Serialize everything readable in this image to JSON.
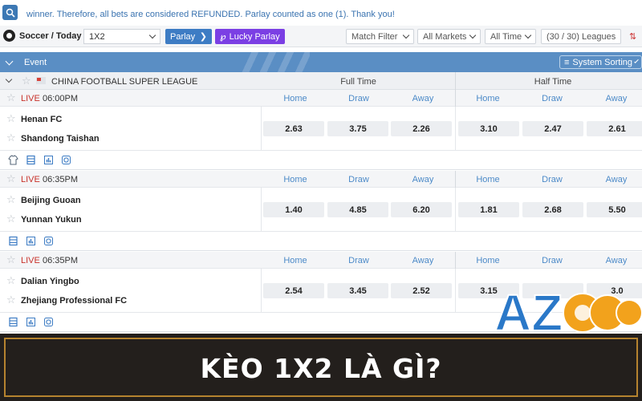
{
  "ticker": {
    "message": "winner. Therefore, all bets are considered REFUNDED. Parlay counted as one (1). Thank you!"
  },
  "filters": {
    "sport": "Soccer / Today",
    "market": "1X2",
    "parlay": "Parlay",
    "lucky_parlay": "Lucky Parlay",
    "match_filter": "Match Filter",
    "all_markets": "All Markets",
    "all_time": "All Time",
    "leagues": "(30 / 30) Leagues"
  },
  "event_header": {
    "label": "Event",
    "sort": "System Sorting"
  },
  "league": {
    "name": "CHINA FOOTBALL SUPER LEAGUE",
    "full_time": "Full Time",
    "half_time": "Half Time"
  },
  "odds_labels": {
    "home": "Home",
    "draw": "Draw",
    "away": "Away"
  },
  "matches": [
    {
      "status": "LIVE",
      "time": "06:00PM",
      "home": "Henan FC",
      "away": "Shandong Taishan",
      "ft": [
        "2.63",
        "3.75",
        "2.26"
      ],
      "ht": [
        "3.10",
        "2.47",
        "2.61"
      ]
    },
    {
      "status": "LIVE",
      "time": "06:35PM",
      "home": "Beijing Guoan",
      "away": "Yunnan Yukun",
      "ft": [
        "1.40",
        "4.85",
        "6.20"
      ],
      "ht": [
        "1.81",
        "2.68",
        "5.50"
      ]
    },
    {
      "status": "LIVE",
      "time": "06:35PM",
      "home": "Dalian Yingbo",
      "away": "Zhejiang Professional FC",
      "ft": [
        "2.54",
        "3.45",
        "2.52"
      ],
      "ht": [
        "3.15",
        "",
        "3.0"
      ]
    }
  ],
  "banner": {
    "title": "KÈO 1X2 LÀ GÌ?"
  },
  "logo": {
    "text": "AZ888",
    "colors": {
      "az": "#2a78c8",
      "digits": "#f2a21c"
    }
  },
  "colors": {
    "accent_blue": "#3d7cc4",
    "lucky_purple": "#7b3fe4",
    "live_red": "#c8322b",
    "header_blue": "#5a8ec4",
    "banner_bg": "#231f1c",
    "banner_border": "#b5832f"
  }
}
